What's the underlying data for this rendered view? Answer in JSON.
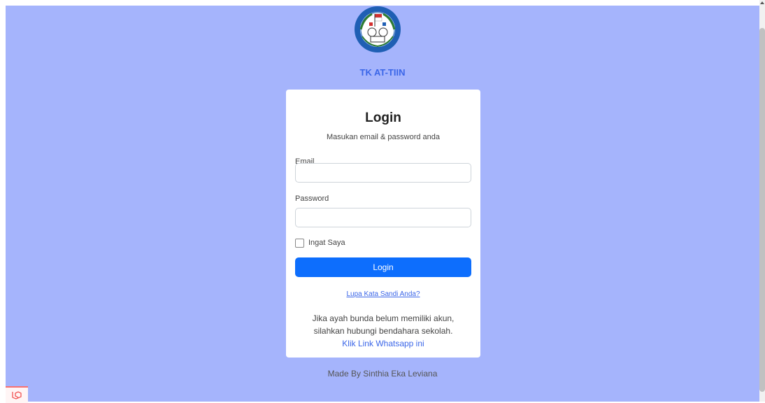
{
  "brand": {
    "name": "TK AT-TIIN",
    "logo_icon": "school-emblem-icon",
    "color": "#3b66e8"
  },
  "login": {
    "title": "Login",
    "subtitle": "Masukan email & password anda",
    "email_label": "Email",
    "email_value": "",
    "password_label": "Password",
    "password_value": "",
    "remember_label": "Ingat Saya",
    "remember_checked": false,
    "submit_label": "Login",
    "forgot_link": "Lupa Kata Sandi Anda?",
    "info_line1": "Jika ayah bunda belum memiliki akun,",
    "info_line2": "silahkan hubungi bendahara sekolah.",
    "whatsapp_link": "Klik Link Whatsapp ini"
  },
  "footer": {
    "credit": "Made By Sinthia Eka Leviana"
  },
  "colors": {
    "page_bg": "#a5b4fc",
    "primary": "#0d6efd",
    "link": "#3b66e8"
  }
}
